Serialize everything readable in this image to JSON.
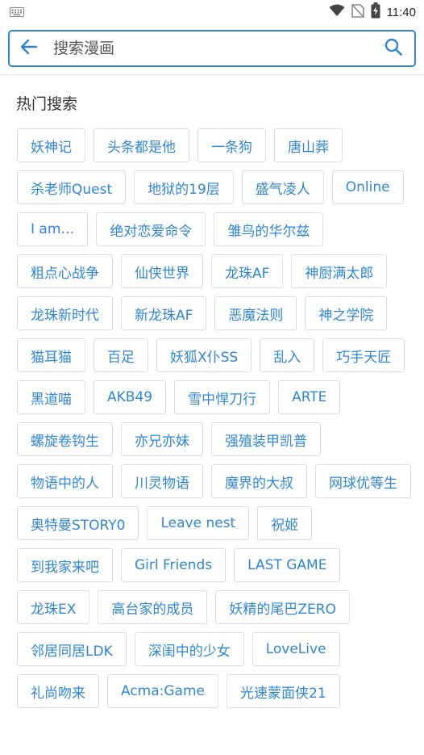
{
  "status_bar": {
    "time": "11:40",
    "icons": [
      "keyboard-icon",
      "wifi-icon",
      "no-signal-icon",
      "battery-charging-icon"
    ]
  },
  "search": {
    "placeholder": "搜索漫画",
    "value": ""
  },
  "hot": {
    "title": "热门搜索",
    "tags": [
      "妖神记",
      "头条都是他",
      "一条狗",
      "唐山葬",
      "杀老师Quest",
      "地狱的19层",
      "盛气凌人",
      "Online",
      "I am…",
      "绝对恋爱命令",
      "雏鸟的华尔兹",
      "粗点心战争",
      "仙侠世界",
      "龙珠AF",
      "神厨满太郎",
      "龙珠新时代",
      "新龙珠AF",
      "恶魔法则",
      "神之学院",
      "猫耳猫",
      "百足",
      "妖狐X仆SS",
      "乱入",
      "巧手天匠",
      "黑道喵",
      "AKB49",
      "雪中悍刀行",
      "ARTE",
      "螺旋卷钩生",
      "亦兄亦妹",
      "强殖装甲凯普",
      "物语中的人",
      "川灵物语",
      "魔界的大叔",
      "网球优等生",
      "奥特曼STORY0",
      "Leave nest",
      "祝姬",
      "到我家来吧",
      "Girl Friends",
      "LAST GAME",
      "龙珠EX",
      "高台家的成员",
      "妖精的尾巴ZERO",
      "邻居同居LDK",
      "深闺中的少女",
      "LoveLive",
      "礼尚吻来",
      "Acma:Game",
      "光速蒙面侠21"
    ]
  },
  "colors": {
    "accent": "#2f86d8",
    "tag_border": "#dcdcdc",
    "divider": "#e4e4e4"
  }
}
